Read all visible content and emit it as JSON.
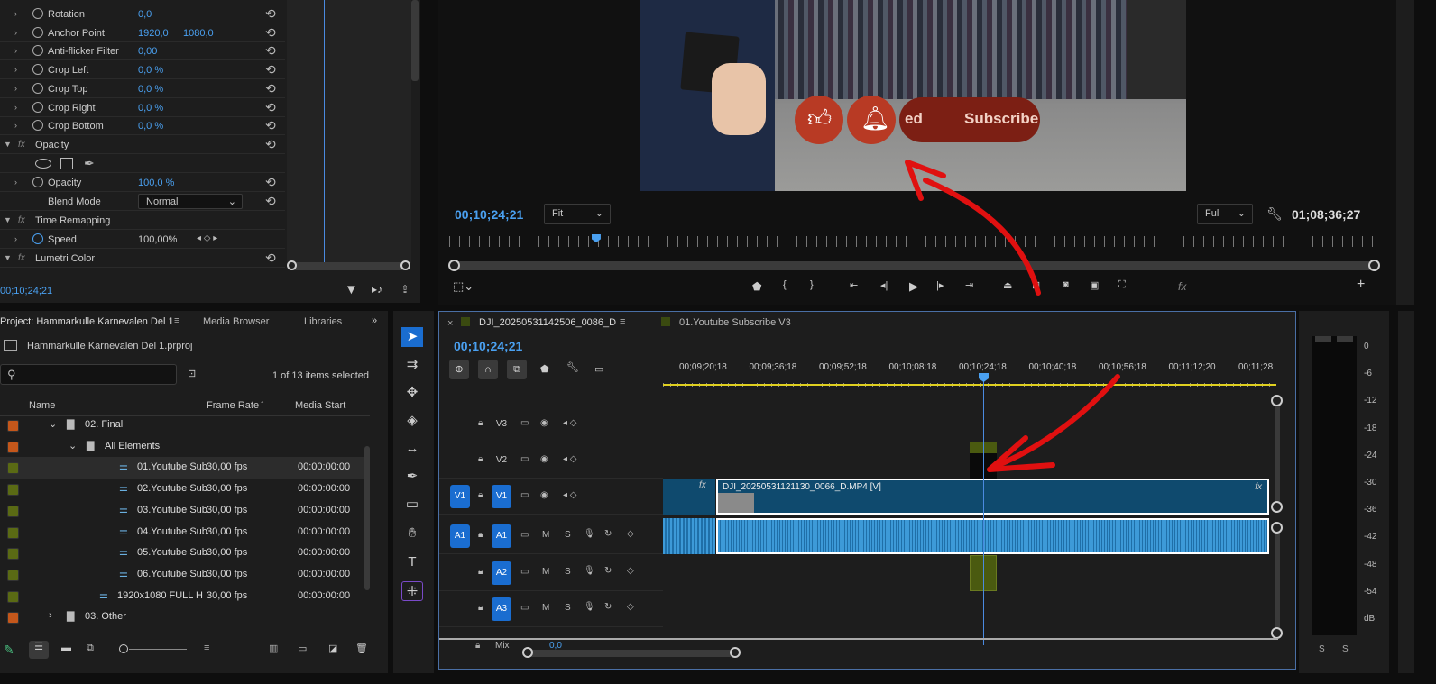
{
  "effects": {
    "rows": [
      {
        "name": "Rotation",
        "v1": "0,0",
        "v2": ""
      },
      {
        "name": "Anchor Point",
        "v1": "1920,0",
        "v2": "1080,0"
      },
      {
        "name": "Anti-flicker Filter",
        "v1": "0,00",
        "v2": ""
      },
      {
        "name": "Crop Left",
        "v1": "0,0 %",
        "v2": ""
      },
      {
        "name": "Crop Top",
        "v1": "0,0 %",
        "v2": ""
      },
      {
        "name": "Crop Right",
        "v1": "0,0 %",
        "v2": ""
      },
      {
        "name": "Crop Bottom",
        "v1": "0,0 %",
        "v2": ""
      }
    ],
    "opacity_section": "Opacity",
    "opacity_label": "Opacity",
    "opacity_value": "100,0 %",
    "blend_label": "Blend Mode",
    "blend_value": "Normal",
    "time_remap": "Time Remapping",
    "speed_label": "Speed",
    "speed_value": "100,00%",
    "lumetri": "Lumetri Color",
    "timecode": "00;10;24;21",
    "fx_glyph": "fx"
  },
  "program": {
    "timecode": "00;10;24;21",
    "fit": "Fit",
    "quality": "Full",
    "duration": "01;08;36;27",
    "overlay_text_left": "ed",
    "overlay_text_right": "Subscribe",
    "playhead_fraction": 0.152
  },
  "project": {
    "title": "Project: Hammarkulle Karnevalen Del 1",
    "tab_media": "Media Browser",
    "tab_libraries": "Libraries",
    "file": "Hammarkulle Karnevalen Del 1.prproj",
    "selected_count": "1 of 13 items selected",
    "col_name": "Name",
    "col_fr": "Frame Rate",
    "col_ms": "Media Start",
    "items": [
      {
        "name": "02. Final",
        "type": "folder",
        "indent": 0,
        "fr": "",
        "ms": "",
        "color": "#c4571b"
      },
      {
        "name": "All Elements",
        "type": "folder",
        "indent": 1,
        "fr": "",
        "ms": "",
        "color": "#c4571b"
      },
      {
        "name": "01.Youtube Sub",
        "type": "seq",
        "indent": 2,
        "fr": "30,00 fps",
        "ms": "00:00:00:00",
        "color": "#5a6a14"
      },
      {
        "name": "02.Youtube Sub",
        "type": "seq",
        "indent": 2,
        "fr": "30,00 fps",
        "ms": "00:00:00:00",
        "color": "#5a6a14"
      },
      {
        "name": "03.Youtube Sub",
        "type": "seq",
        "indent": 2,
        "fr": "30,00 fps",
        "ms": "00:00:00:00",
        "color": "#5a6a14"
      },
      {
        "name": "04.Youtube Sub",
        "type": "seq",
        "indent": 2,
        "fr": "30,00 fps",
        "ms": "00:00:00:00",
        "color": "#5a6a14"
      },
      {
        "name": "05.Youtube Sub",
        "type": "seq",
        "indent": 2,
        "fr": "30,00 fps",
        "ms": "00:00:00:00",
        "color": "#5a6a14"
      },
      {
        "name": "06.Youtube Sub",
        "type": "seq",
        "indent": 2,
        "fr": "30,00 fps",
        "ms": "00:00:00:00",
        "color": "#5a6a14"
      },
      {
        "name": "1920x1080 FULL H",
        "type": "seq",
        "indent": 1,
        "fr": "30,00 fps",
        "ms": "00:00:00:00",
        "color": "#5a6a14"
      },
      {
        "name": "03. Other",
        "type": "folder",
        "indent": 0,
        "fr": "",
        "ms": "",
        "color": "#c4571b"
      }
    ]
  },
  "timeline": {
    "tab1": "DJI_20250531142506_0086_D",
    "tab2": "01.Youtube Subscribe V3",
    "timecode": "00;10;24;21",
    "ruler": [
      "00;09;20;18",
      "00;09;36;18",
      "00;09;52;18",
      "00;10;08;18",
      "00;10;24;18",
      "00;10;40;18",
      "00;10;56;18",
      "00;11;12;20",
      "00;11;28"
    ],
    "tracks_video": [
      "V3",
      "V2",
      "V1"
    ],
    "tracks_audio": [
      "A1",
      "A2",
      "A3"
    ],
    "src_v": "V1",
    "src_a": "A1",
    "clip_name": "DJI_20250531121130_0066_D.MP4 [V]",
    "mix": "Mix",
    "mix_val": "0,0",
    "m_label": "M",
    "s_label": "S",
    "fx_glyph": "fx"
  },
  "meters": {
    "scale": [
      "0",
      "-6",
      "-12",
      "-18",
      "-24",
      "-30",
      "-36",
      "-42",
      "-48",
      "-54",
      "dB"
    ],
    "solo": [
      "S",
      "S"
    ]
  }
}
